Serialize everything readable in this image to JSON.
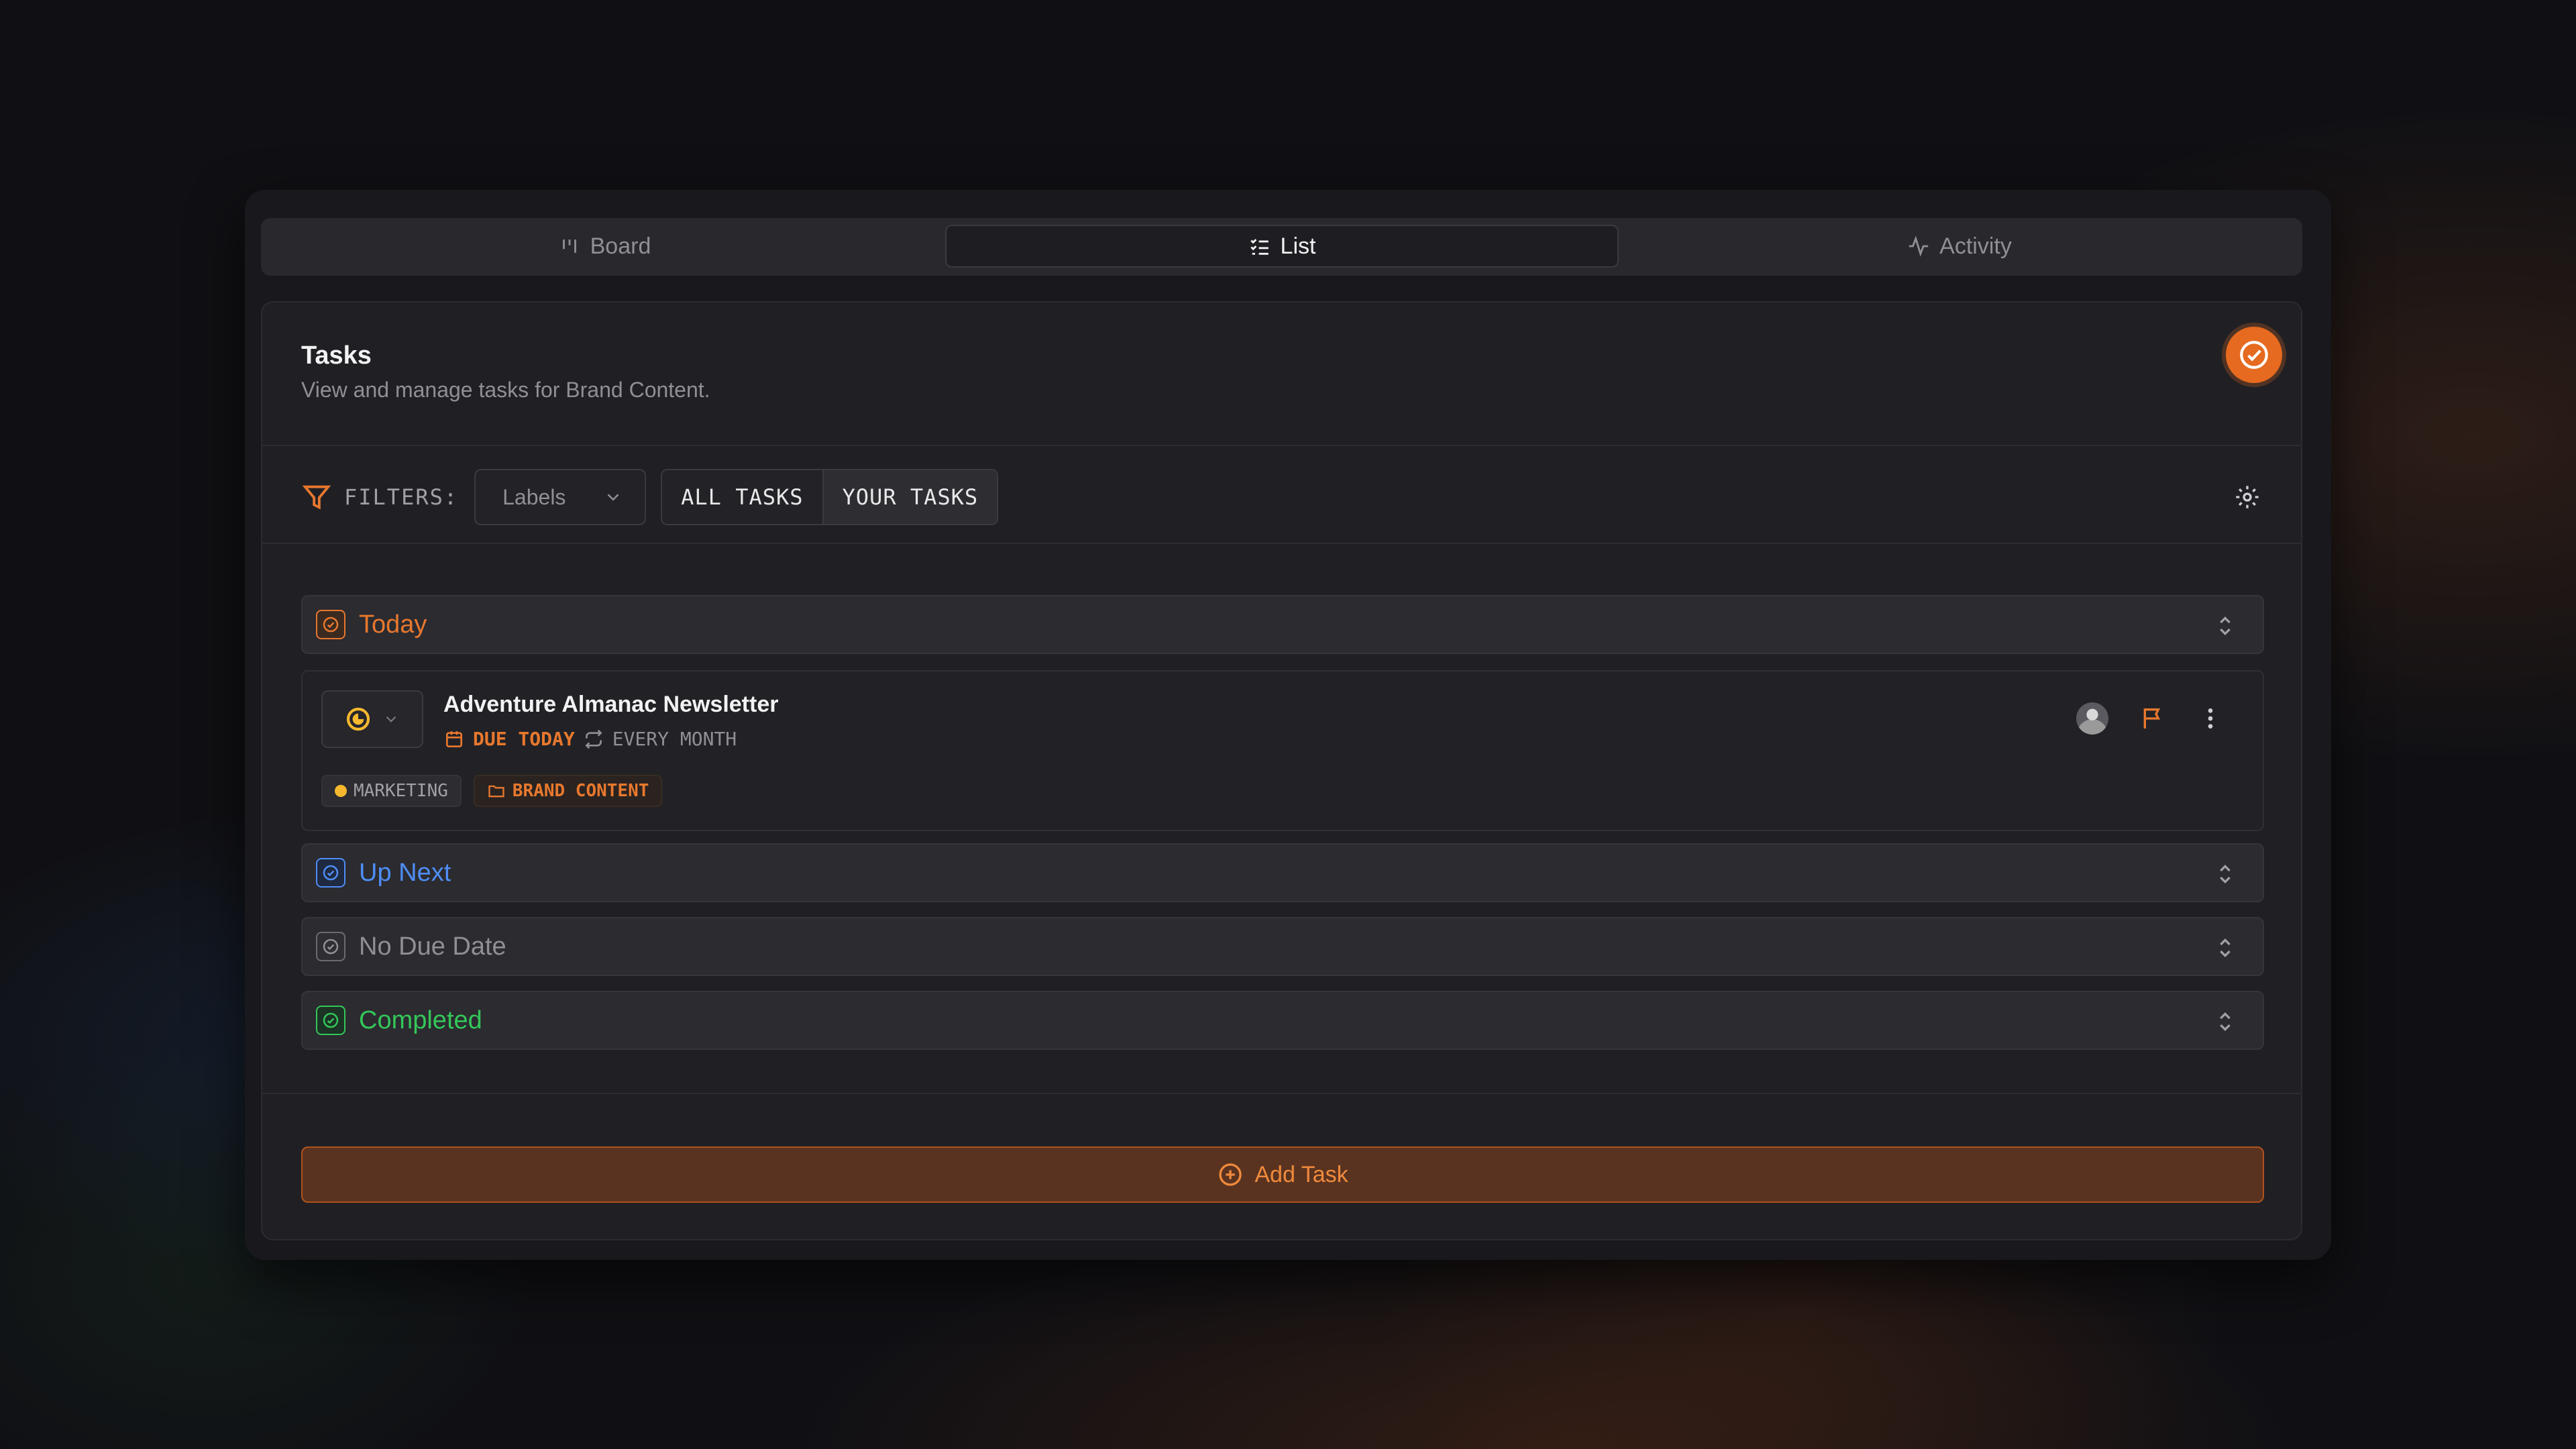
{
  "tabs": [
    {
      "label": "Board",
      "icon": "board-icon",
      "active": false
    },
    {
      "label": "List",
      "icon": "list-icon",
      "active": true
    },
    {
      "label": "Activity",
      "icon": "activity-icon",
      "active": false
    }
  ],
  "header": {
    "title": "Tasks",
    "subtitle": "View and manage tasks for Brand Content.",
    "app_icon": "check-circle-icon"
  },
  "filters": {
    "label": "FILTERS:",
    "labels_select": "Labels",
    "scope_options": [
      "ALL TASKS",
      "YOUR TASKS"
    ]
  },
  "sections": [
    {
      "label": "Today",
      "color": "#e8782e",
      "expanded": true
    },
    {
      "label": "Up Next",
      "color": "#4f8df5"
    },
    {
      "label": "No Due Date",
      "color": "#8f8f96"
    },
    {
      "label": "Completed",
      "color": "#34c759"
    }
  ],
  "task": {
    "title": "Adventure Almanac Newsletter",
    "due": "DUE TODAY",
    "recurrence": "EVERY MONTH",
    "tags": [
      "MARKETING",
      "BRAND CONTENT"
    ]
  },
  "add_button": "Add Task",
  "colors": {
    "accent": "#e8782e",
    "background": "#101014",
    "card": "#19191d"
  }
}
